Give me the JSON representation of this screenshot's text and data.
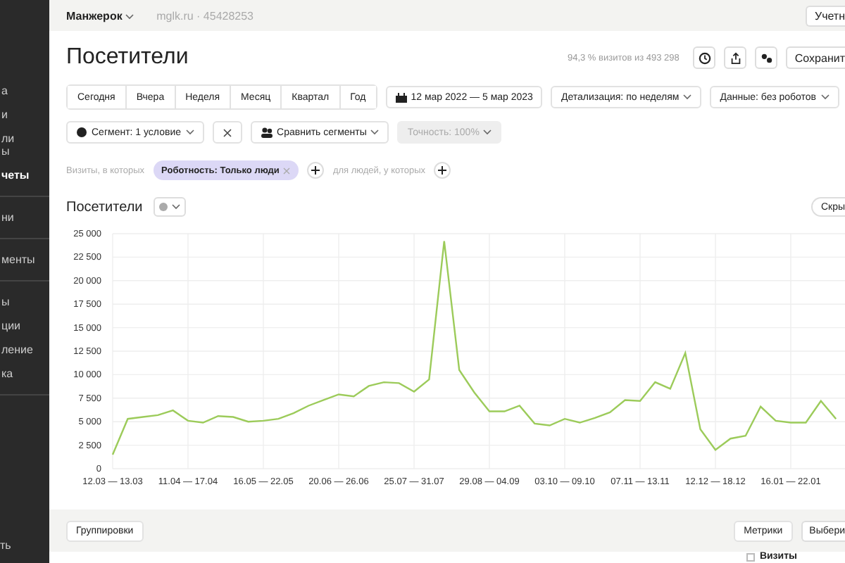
{
  "sidebar": {
    "groups": [
      [
        {
          "label": "а",
          "selected": false
        },
        {
          "label": "и",
          "selected": false
        },
        {
          "label": "ли\nы",
          "selected": false
        },
        {
          "label": "четы",
          "selected": true
        }
      ],
      [
        {
          "label": "ни",
          "selected": false
        }
      ],
      [
        {
          "label": "менты",
          "selected": false
        }
      ],
      [
        {
          "label": "ы",
          "selected": false
        },
        {
          "label": "ции",
          "selected": false
        },
        {
          "label": "ление",
          "selected": false
        },
        {
          "label": "ка",
          "selected": false
        }
      ]
    ],
    "footer": "ть"
  },
  "topbar": {
    "counter": "Манжерок",
    "site": "mglk.ru · 45428253",
    "button": "Учетн"
  },
  "header": {
    "title": "Посетители",
    "stats": "94,3 % визитов из 493 298",
    "save": "Сохранит"
  },
  "periods": [
    {
      "label": "Сегодня",
      "selected": false
    },
    {
      "label": "Вчера",
      "selected": false
    },
    {
      "label": "Неделя",
      "selected": false
    },
    {
      "label": "Месяц",
      "selected": false
    },
    {
      "label": "Квартал",
      "selected": false
    },
    {
      "label": "Год",
      "selected": false
    }
  ],
  "date_range": "12 мар 2022 — 5 мар 2023",
  "detail": "Детализация: по неделям",
  "data_mode": "Данные: без роботов",
  "segment": {
    "label": "Сегмент: 1 условие",
    "compare": "Сравнить сегменты",
    "accuracy": "Точность: 100%",
    "accuracy_disabled": true
  },
  "filter": {
    "prefix": "Визиты, в которых",
    "chip": "Роботность: Только люди",
    "middle": "для людей, у которых"
  },
  "chart": {
    "title": "Посетители",
    "hide": "Скры",
    "chart_data": {
      "type": "line",
      "categories": [
        "12.03 — 13.03",
        null,
        null,
        null,
        null,
        "11.04 — 17.04",
        null,
        null,
        null,
        null,
        "16.05 — 22.05",
        null,
        null,
        null,
        null,
        "20.06 — 26.06",
        null,
        null,
        null,
        null,
        "25.07 — 31.07",
        null,
        null,
        null,
        null,
        "29.08 — 04.09",
        null,
        null,
        null,
        null,
        "03.10 — 09.10",
        null,
        null,
        null,
        null,
        "07.11 — 13.11",
        null,
        null,
        null,
        null,
        "12.12 — 18.12",
        null,
        null,
        null,
        null,
        "16.01 — 22.01",
        null,
        null,
        null
      ],
      "series": [
        {
          "color": "#9ccb5a",
          "values": [
            1500,
            5300,
            5500,
            5700,
            6200,
            5100,
            4900,
            5600,
            5500,
            5000,
            5100,
            5300,
            5900,
            6700,
            7300,
            7900,
            7700,
            8800,
            9200,
            9100,
            8200,
            9500,
            24200,
            10500,
            8100,
            6100,
            6100,
            6700,
            4800,
            4600,
            5300,
            4900,
            5400,
            6000,
            7300,
            7200,
            9200,
            8500,
            12300,
            4200,
            2000,
            3200,
            3500,
            6600,
            5100,
            4900,
            4900,
            7200,
            5300
          ]
        }
      ],
      "ylim": [
        0,
        25000
      ],
      "yticks": [
        {
          "value": 0,
          "label": "0"
        },
        {
          "value": 2500,
          "label": "2 500"
        },
        {
          "value": 5000,
          "label": "5 000"
        },
        {
          "value": 7500,
          "label": "7 500"
        },
        {
          "value": 10000,
          "label": "10 000"
        },
        {
          "value": 12500,
          "label": "12 500"
        },
        {
          "value": 15000,
          "label": "15 000"
        },
        {
          "value": 17500,
          "label": "17 500"
        },
        {
          "value": 20000,
          "label": "20 000"
        },
        {
          "value": 22500,
          "label": "22 500"
        },
        {
          "value": 25000,
          "label": "25 000"
        }
      ],
      "grid": true
    }
  },
  "bottom": {
    "groupings": "Группировки",
    "metrics": "Метрики",
    "choose": "Выбери",
    "legend": {
      "label": "Визиты",
      "checked": false
    }
  }
}
